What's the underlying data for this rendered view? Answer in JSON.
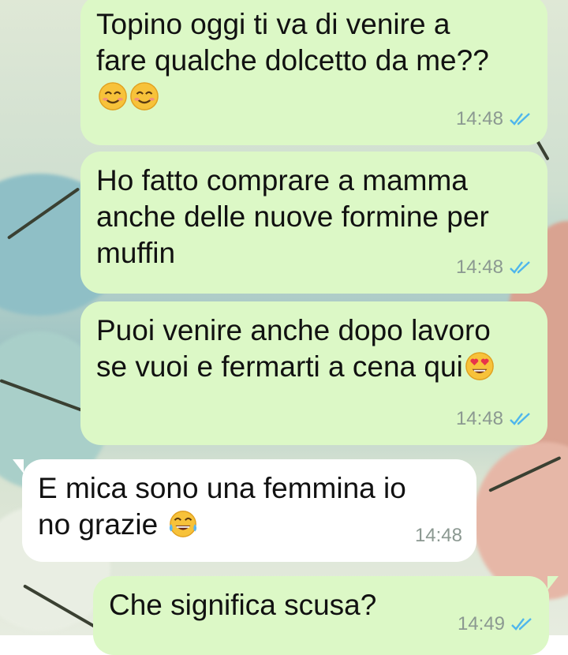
{
  "messages": [
    {
      "direction": "outgoing",
      "text": "Topino oggi ti va di venire a fare qualche dolcetto da me??",
      "emojis": [
        "smiling-face",
        "smiling-face"
      ],
      "time": "14:48",
      "status": "read"
    },
    {
      "direction": "outgoing",
      "text": "Ho fatto comprare a mamma anche delle nuove formine per muffin",
      "emojis": [],
      "time": "14:48",
      "status": "read"
    },
    {
      "direction": "outgoing",
      "text": "Puoi venire anche dopo lavoro se vuoi e fermarti a cena qui",
      "emojis": [
        "heart-eyes-face"
      ],
      "time": "14:48",
      "status": "read"
    },
    {
      "direction": "incoming",
      "text": "E mica sono una femmina io no grazie ",
      "emojis": [
        "tears-of-joy-face"
      ],
      "time": "14:48"
    },
    {
      "direction": "outgoing",
      "text": "Che significa scusa?",
      "emojis": [],
      "time": "14:49",
      "status": "read"
    }
  ],
  "colors": {
    "outgoing_bubble": "#dcf8c6",
    "incoming_bubble": "#ffffff",
    "read_ticks": "#4fb6ec",
    "timestamp": "#8b9891"
  }
}
